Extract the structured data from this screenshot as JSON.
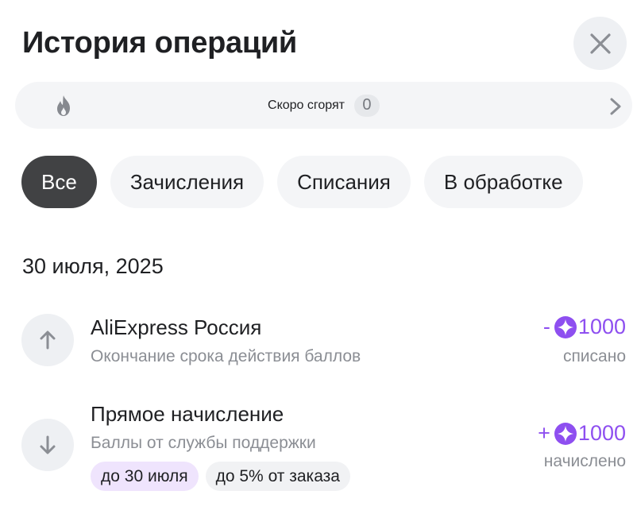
{
  "header": {
    "title": "История операций",
    "close_icon": "close-icon"
  },
  "burn": {
    "label": "Скоро сгорят",
    "count": "0",
    "icon": "fire-icon"
  },
  "tabs": [
    {
      "label": "Все",
      "active": true
    },
    {
      "label": "Зачисления",
      "active": false
    },
    {
      "label": "Списания",
      "active": false
    },
    {
      "label": "В обработке",
      "active": false
    }
  ],
  "date": "30 июля, 2025",
  "operations": [
    {
      "title": "AliExpress Россия",
      "subtitle": "Окончание срока действия баллов",
      "sign": "-",
      "amount": "1000",
      "status": "списано",
      "icon": "arrow-up-icon"
    },
    {
      "title": "Прямое начисление",
      "subtitle": "Баллы от службы поддержки",
      "sign": "+",
      "amount": "1000",
      "status": "начислено",
      "icon": "arrow-down-icon",
      "tags": [
        "до 30 июля",
        "до 5% от заказа"
      ]
    }
  ],
  "colors": {
    "accent": "#8e4ff0",
    "active_tab": "#414244",
    "muted": "#8b8e94"
  }
}
